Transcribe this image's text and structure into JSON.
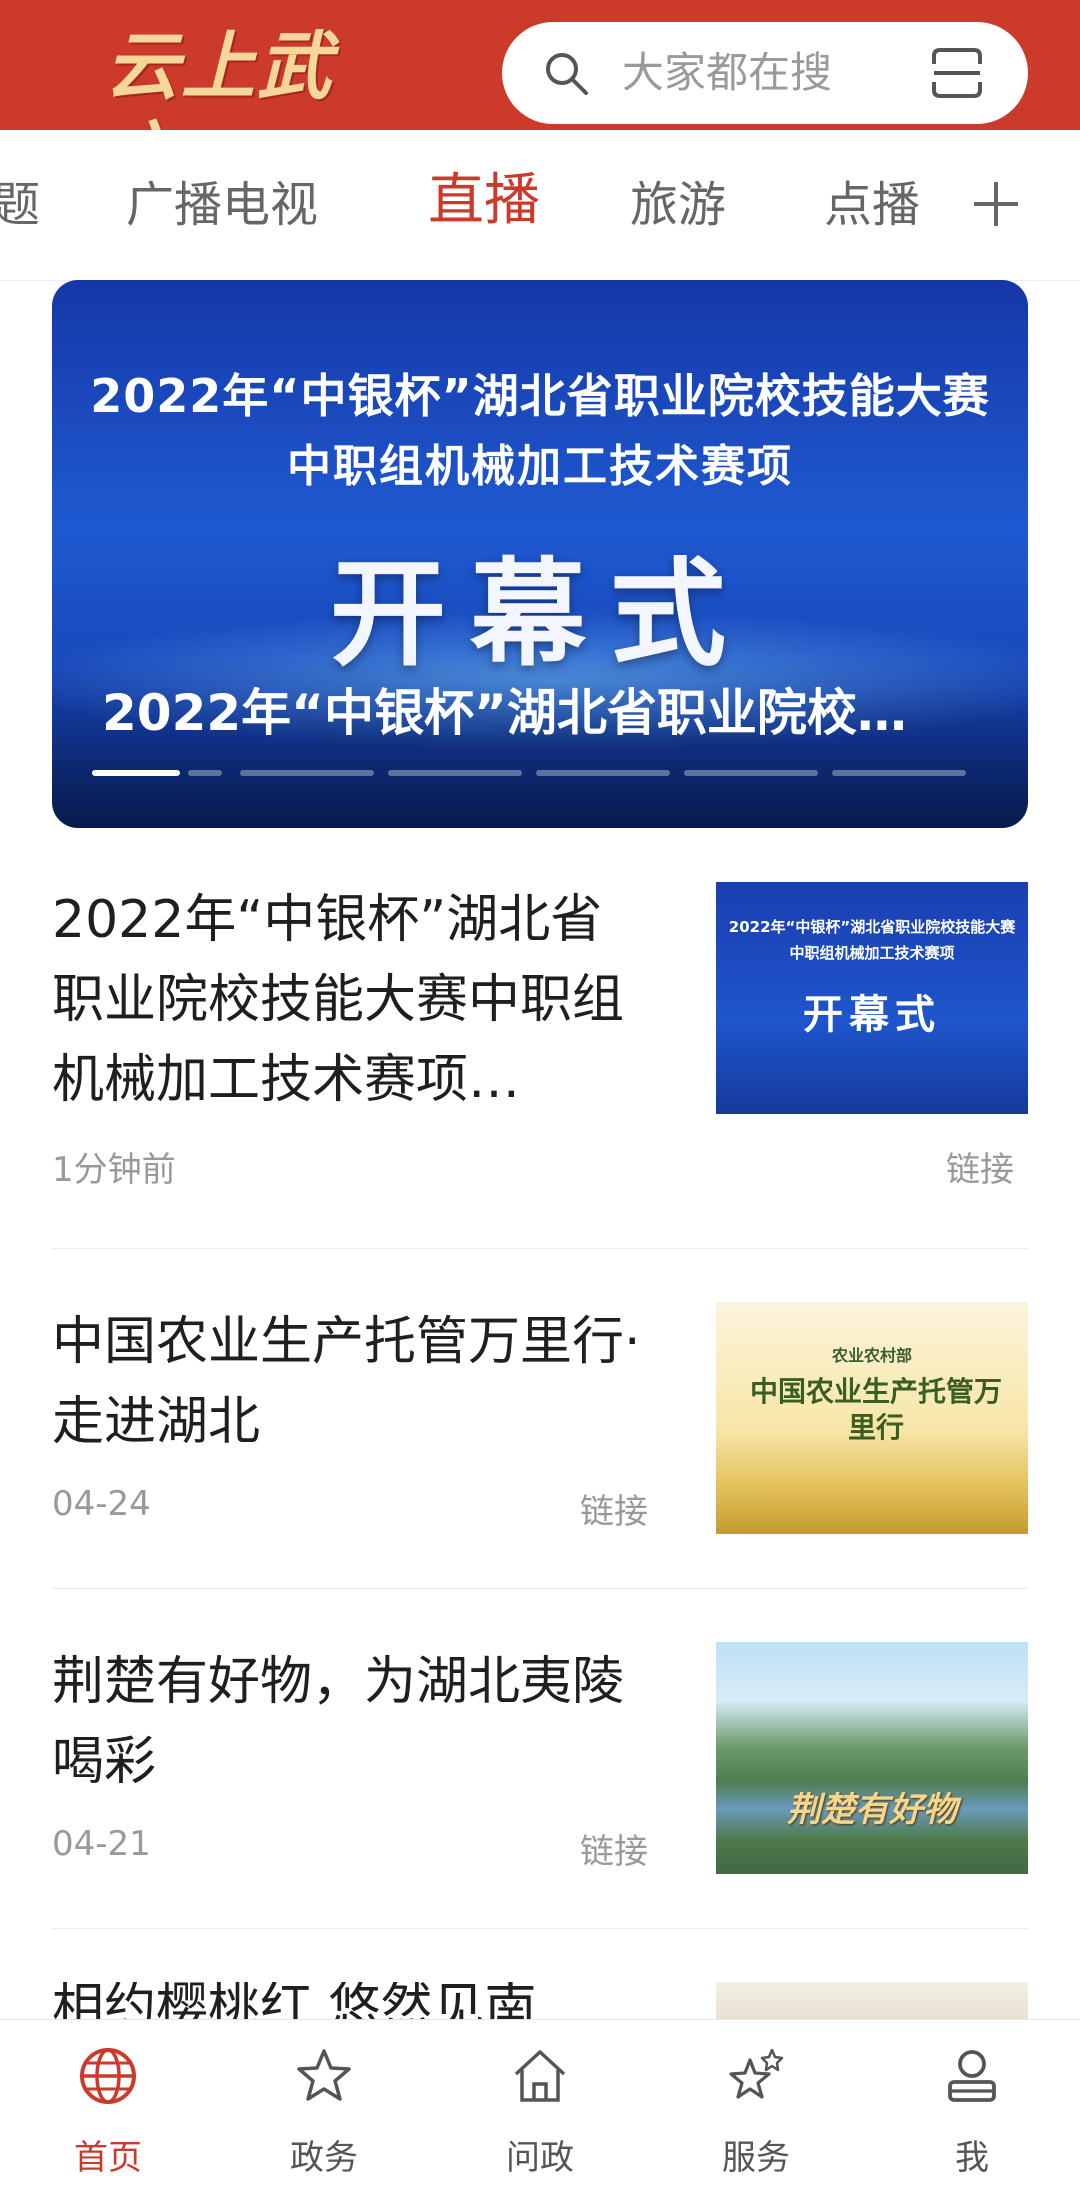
{
  "header": {
    "logo_text": "云上武穴",
    "search_placeholder": "大家都在搜",
    "brand_color": "#cc3a2c"
  },
  "tabs": [
    {
      "label": "题",
      "active": false
    },
    {
      "label": "广播电视",
      "active": false
    },
    {
      "label": "直播",
      "active": true
    },
    {
      "label": "旅游",
      "active": false
    },
    {
      "label": "点播",
      "active": false
    }
  ],
  "banner": {
    "image_line1": "2022年“中银杯”湖北省职业院校技能大赛",
    "image_line2": "中职组机械加工技术赛项",
    "image_big": "开幕式",
    "caption": "2022年“中银杯”湖北省职业院校…",
    "slide_count": 6,
    "active_slide": 1
  },
  "news": [
    {
      "title": "2022年“中银杯”湖北省职业院校技能大赛中职组机械加工技术赛项…",
      "time": "1分钟前",
      "tag": "链接",
      "thumb_line1": "2022年“中银杯”湖北省职业院校技能大赛",
      "thumb_line2": "中职组机械加工技术赛项",
      "thumb_big": "开幕式"
    },
    {
      "title": "中国农业生产托管万里行·走进湖北",
      "time": "04-24",
      "tag": "链接",
      "thumb_line1": "农业农村部",
      "thumb_big": "中国农业生产托管万里行"
    },
    {
      "title": "荆楚有好物，为湖北夷陵喝彩",
      "time": "04-21",
      "tag": "链接",
      "thumb_big": "荆楚有好物"
    },
    {
      "title": "相约樱桃红 悠然见南"
    }
  ],
  "bottom_nav": [
    {
      "label": "首页",
      "icon": "globe-icon",
      "active": true
    },
    {
      "label": "政务",
      "icon": "star-icon",
      "active": false
    },
    {
      "label": "问政",
      "icon": "home-icon",
      "active": false
    },
    {
      "label": "服务",
      "icon": "stars-icon",
      "active": false
    },
    {
      "label": "我",
      "icon": "user-icon",
      "active": false
    }
  ]
}
